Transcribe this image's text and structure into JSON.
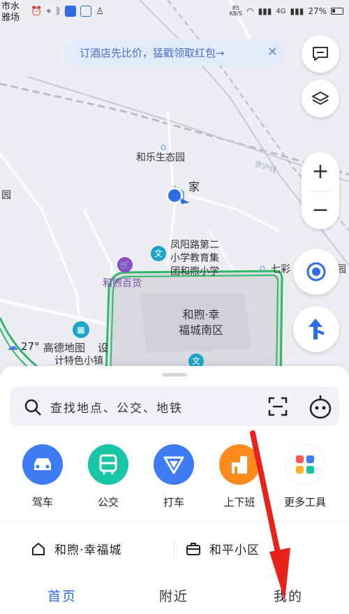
{
  "status_bar": {
    "left_text_1": "市水",
    "left_text_2": "雅场",
    "network_speed": "85\nKB/S",
    "network_type": "4G",
    "battery": "27%"
  },
  "promo": {
    "text": "订酒店先比价，猛戳领取红包→",
    "close": "✕"
  },
  "map": {
    "labels": {
      "hele_park": "和乐生态园",
      "home": "家",
      "school_1": "凤阳路第二",
      "school_2": "小学教育集",
      "school_3": "团和煦小学",
      "shop": "和煦百货",
      "district_1": "和煦·幸",
      "district_2": "福城南区",
      "weather": "27°",
      "gaode_1": "高德地图",
      "gaode_2": "计特色小镇",
      "she": "设",
      "qicai": "七彩",
      "yuan_left": "园",
      "yuan_right": "园",
      "road": "京沪线"
    }
  },
  "sheet": {
    "search_placeholder": "查找地点、公交、地铁",
    "quick_actions": [
      {
        "label": "驾车",
        "color": "#3d7cf4"
      },
      {
        "label": "公交",
        "color": "#18c6a5"
      },
      {
        "label": "打车",
        "color": "#3d7cf4"
      },
      {
        "label": "上下班",
        "color": "#ff8b1f"
      },
      {
        "label": "更多工具",
        "color": "#ffffff"
      }
    ],
    "places": [
      {
        "label": "和煦·幸福城"
      },
      {
        "label": "和平小区"
      }
    ]
  },
  "tabbar": {
    "tabs": [
      {
        "label": "首页"
      },
      {
        "label": "附近"
      },
      {
        "label": "我的"
      }
    ]
  },
  "colors": {
    "accent": "#2f6de8",
    "district_border": "#2fb86a",
    "annotation_arrow": "#e8231c"
  }
}
